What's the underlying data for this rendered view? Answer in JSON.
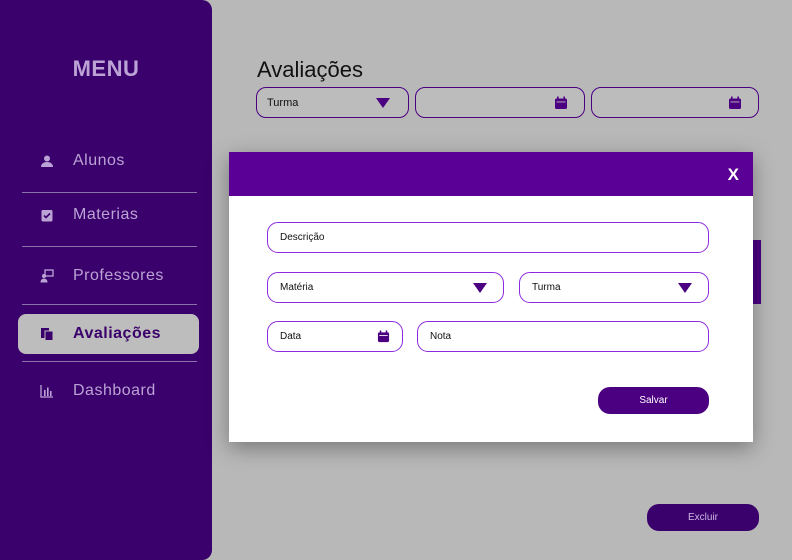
{
  "sidebar": {
    "title": "MENU",
    "items": [
      {
        "label": "Alunos",
        "icon": "student-icon"
      },
      {
        "label": "Materias",
        "icon": "clipboard-check-icon"
      },
      {
        "label": "Professores",
        "icon": "teacher-icon"
      },
      {
        "label": "Avaliações",
        "icon": "documents-icon",
        "active": true
      },
      {
        "label": "Dashboard",
        "icon": "bar-chart-icon"
      }
    ]
  },
  "page": {
    "title": "Avaliações",
    "filters": {
      "turma": "Turma",
      "date_start": "",
      "date_end": ""
    },
    "delete_label": "Excluir"
  },
  "modal": {
    "close_label": "X",
    "descricao": "Descrição",
    "materia": "Matéria",
    "turma": "Turma",
    "data": "Data",
    "nota": "Nota",
    "save_label": "Salvar"
  },
  "colors": {
    "primary": "#4b0082",
    "sidebar": "#3a006b",
    "header": "#5a0096",
    "overlay": "#b8b8b8"
  }
}
